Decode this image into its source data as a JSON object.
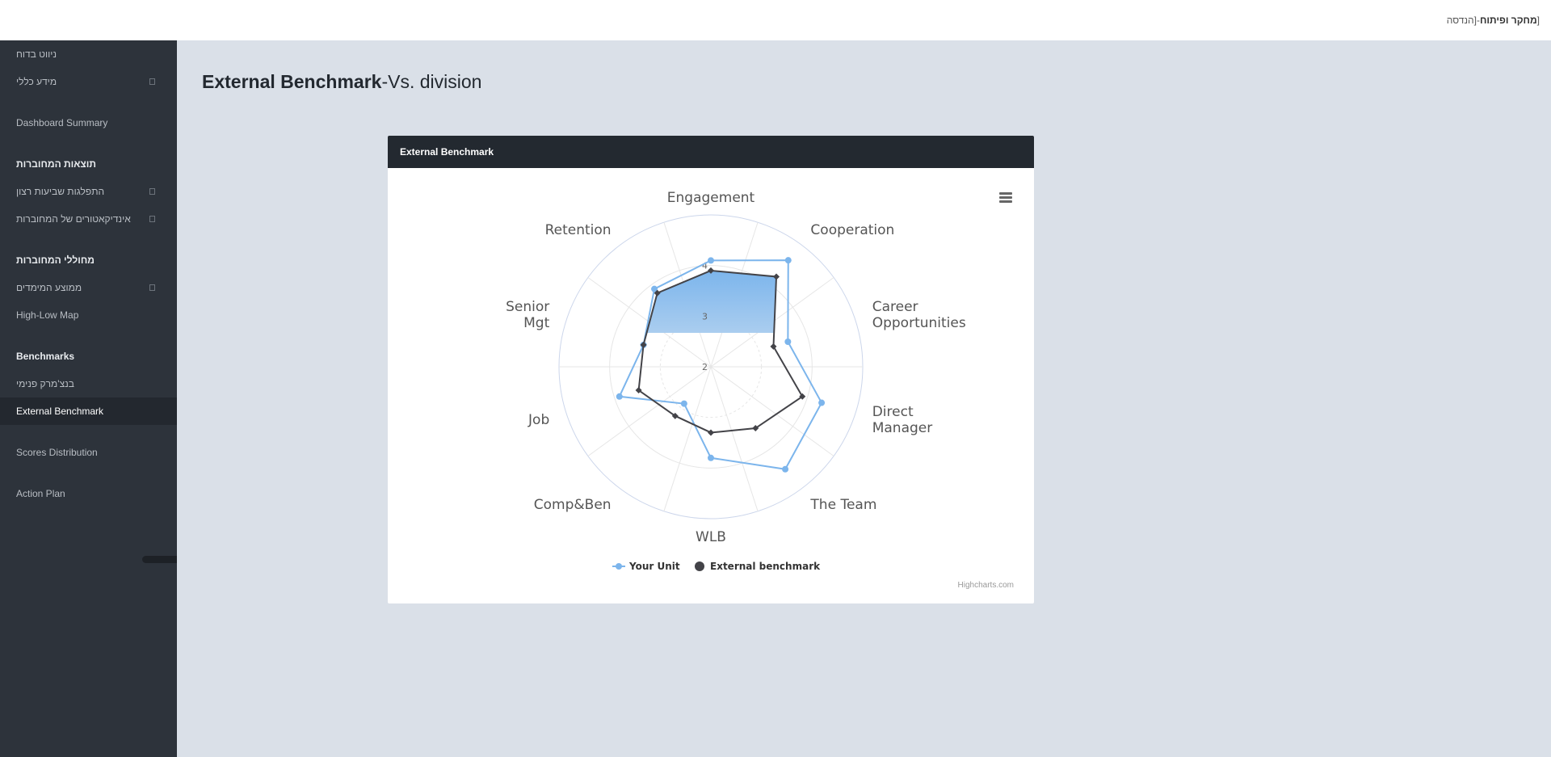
{
  "topbar": {
    "breadcrumb_bold": "מחקר ופיתוח",
    "breadcrumb_rest": "-[הנדסה",
    "bracket": "["
  },
  "sidebar": {
    "items": [
      {
        "label": "ניווט בדוח",
        "type": "link"
      },
      {
        "label": "מידע כללי",
        "type": "expandable"
      },
      {
        "label": "Dashboard Summary",
        "type": "link"
      },
      {
        "label": "תוצאות המחוברות",
        "type": "heading"
      },
      {
        "label": "התפלגות שביעות רצון",
        "type": "expandable"
      },
      {
        "label": "אינדיקאטורים של המחוברות",
        "type": "expandable"
      },
      {
        "label": "מחוללי המחוברות",
        "type": "heading"
      },
      {
        "label": "ממוצע המימדים",
        "type": "expandable"
      },
      {
        "label": "High-Low Map",
        "type": "link"
      },
      {
        "label": "Benchmarks",
        "type": "heading"
      },
      {
        "label": "בנצ'מרק פנימי",
        "type": "link"
      },
      {
        "label": "External Benchmark",
        "type": "active"
      },
      {
        "label": "Scores Distribution",
        "type": "link"
      },
      {
        "label": "Action Plan",
        "type": "link"
      }
    ]
  },
  "page": {
    "title_bold": "External Benchmark",
    "title_rest": "-Vs. division"
  },
  "card": {
    "title": "External Benchmark",
    "menu_icon": "hamburger-menu-icon",
    "credit": "Highcharts.com"
  },
  "colors": {
    "your_unit": "#7cb5ec",
    "benchmark": "#434348",
    "sidebar_bg": "#2d333b",
    "content_bg": "#dae0e8",
    "card_header_bg": "#232930"
  },
  "chart_data": {
    "type": "line",
    "polar": true,
    "title": "",
    "categories": [
      "Engagement",
      "Cooperation",
      "Career Opportunities",
      "Direct Manager",
      "The Team",
      "WLB",
      "Comp&Ben",
      "Job",
      "Senior Mgt",
      "Retention"
    ],
    "category_label_lines": [
      [
        "Engagement"
      ],
      [
        "Cooperation"
      ],
      [
        "Career",
        "Opportunities"
      ],
      [
        "Direct",
        "Manager"
      ],
      [
        "The Team"
      ],
      [
        "WLB"
      ],
      [
        "Comp&Ben"
      ],
      [
        "Job"
      ],
      [
        "Senior",
        "Mgt"
      ],
      [
        "Retention"
      ]
    ],
    "series": [
      {
        "name": "Your Unit",
        "values": [
          4.1,
          4.6,
          3.6,
          4.3,
          4.5,
          3.8,
          2.9,
          3.9,
          3.4,
          3.9
        ]
      },
      {
        "name": "External benchmark",
        "values": [
          3.9,
          4.2,
          3.3,
          3.9,
          3.5,
          3.3,
          3.2,
          3.5,
          3.4,
          3.8
        ]
      }
    ],
    "ylim": [
      2,
      5
    ],
    "ytick_labels": [
      "2",
      "3",
      "4"
    ],
    "grid": true,
    "legend": "bottom-center"
  }
}
